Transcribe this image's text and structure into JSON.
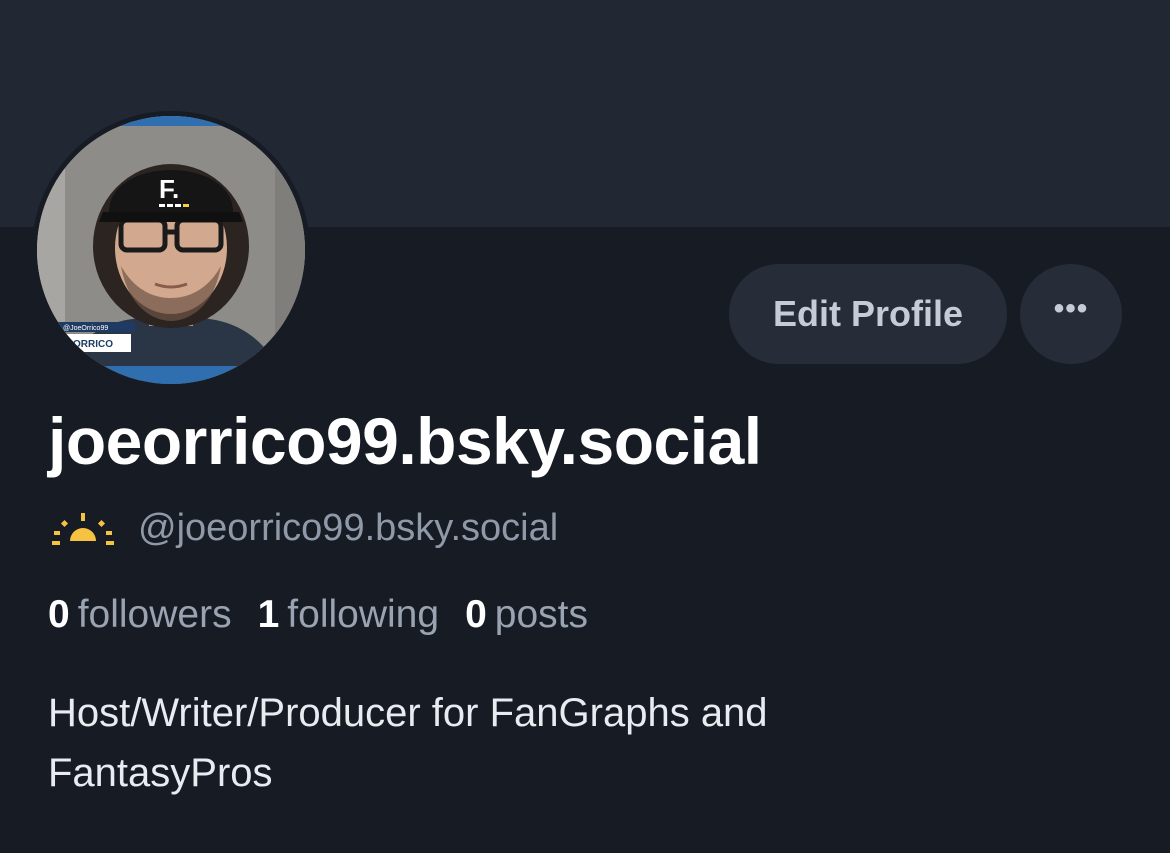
{
  "profile": {
    "display_name": "joeorrico99.bsky.social",
    "handle": "@joeorrico99.bsky.social",
    "handle_icon": "sunrise-icon",
    "avatar_overlay_handle": "@JoeOrrico99",
    "avatar_overlay_name": "ORRICO",
    "bio_line1": "Host/Writer/Producer for FanGraphs and",
    "bio_line2": "FantasyPros"
  },
  "actions": {
    "edit_profile_label": "Edit Profile",
    "more_label": "•••"
  },
  "stats": {
    "followers_count": "0",
    "followers_label": "followers",
    "following_count": "1",
    "following_label": "following",
    "posts_count": "0",
    "posts_label": "posts"
  },
  "colors": {
    "banner": "#212733",
    "background": "#161b24",
    "button_bg": "#272d38",
    "sun_icon": "#f5c242"
  }
}
